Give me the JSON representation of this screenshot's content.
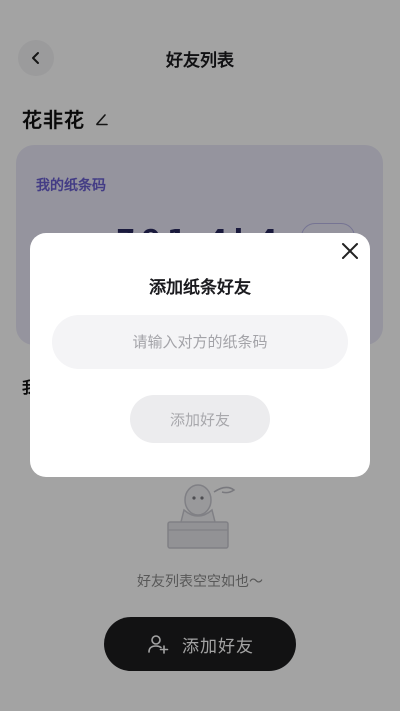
{
  "header": {
    "title": "好友列表"
  },
  "user": {
    "name": "花非花"
  },
  "code_card": {
    "label": "我的纸条码",
    "value": "791 4k4"
  },
  "friends_section": {
    "heading": "我"
  },
  "empty_state": {
    "text": "好友列表空空如也～"
  },
  "bottom_button": {
    "label": "添加好友"
  },
  "modal": {
    "title": "添加纸条好友",
    "input_placeholder": "请输入对方的纸条码",
    "input_value": "",
    "submit_label": "添加好友"
  },
  "colors": {
    "accent": "#6a5fd0",
    "card_bg": "#e9e8f8",
    "button_dark": "#1d1d1f",
    "overlay": "rgba(0,0,0,0.36)"
  }
}
